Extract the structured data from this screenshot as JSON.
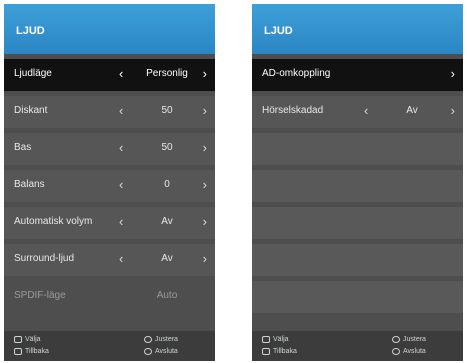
{
  "left_panel": {
    "title": "LJUD",
    "rows": [
      {
        "label": "Ljudläge",
        "value": "Personlig"
      },
      {
        "label": "Diskant",
        "value": "50"
      },
      {
        "label": "Bas",
        "value": "50"
      },
      {
        "label": "Balans",
        "value": "0"
      },
      {
        "label": "Automatisk volym",
        "value": "Av"
      },
      {
        "label": "Surround-ljud",
        "value": "Av"
      },
      {
        "label": "SPDIF-läge",
        "value": "Auto"
      }
    ],
    "footer": {
      "select": "Välja",
      "adjust": "Justera",
      "back": "Tillbaka",
      "exit": "Avsluta"
    }
  },
  "right_panel": {
    "title": "LJUD",
    "rows": [
      {
        "label": "AD-omkoppling"
      },
      {
        "label": "Hörselskadad",
        "value": "Av"
      }
    ],
    "footer": {
      "select": "Välja",
      "adjust": "Justera",
      "back": "Tillbaka",
      "exit": "Avsluta"
    }
  },
  "colors": {
    "header_blue": "#3ea0d8",
    "selected_row": "#111111",
    "panel_background": "#4e4e4e"
  }
}
